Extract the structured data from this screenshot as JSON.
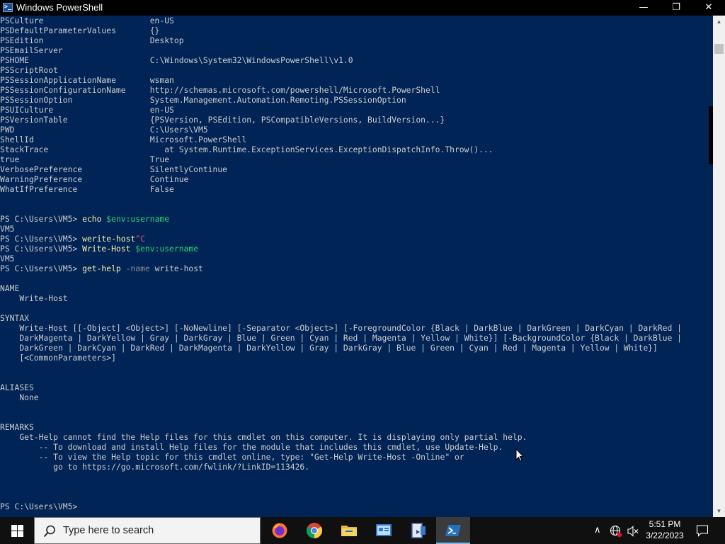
{
  "window": {
    "title": "Windows PowerShell",
    "min_glyph": "—",
    "max_glyph": "❐",
    "close_glyph": "✕"
  },
  "console": {
    "vars": [
      {
        "name": "PSCulture",
        "value": "en-US"
      },
      {
        "name": "PSDefaultParameterValues",
        "value": "{}"
      },
      {
        "name": "PSEdition",
        "value": "Desktop"
      },
      {
        "name": "PSEmailServer",
        "value": ""
      },
      {
        "name": "PSHOME",
        "value": "C:\\Windows\\System32\\WindowsPowerShell\\v1.0"
      },
      {
        "name": "PSScriptRoot",
        "value": ""
      },
      {
        "name": "PSSessionApplicationName",
        "value": "wsman"
      },
      {
        "name": "PSSessionConfigurationName",
        "value": "http://schemas.microsoft.com/powershell/Microsoft.PowerShell"
      },
      {
        "name": "PSSessionOption",
        "value": "System.Management.Automation.Remoting.PSSessionOption"
      },
      {
        "name": "PSUICulture",
        "value": "en-US"
      },
      {
        "name": "PSVersionTable",
        "value": "{PSVersion, PSEdition, PSCompatibleVersions, BuildVersion...}"
      },
      {
        "name": "PWD",
        "value": "C:\\Users\\VM5"
      },
      {
        "name": "ShellId",
        "value": "Microsoft.PowerShell"
      },
      {
        "name": "StackTrace",
        "value": "   at System.Runtime.ExceptionServices.ExceptionDispatchInfo.Throw()..."
      },
      {
        "name": "true",
        "value": "True"
      },
      {
        "name": "VerbosePreference",
        "value": "SilentlyContinue"
      },
      {
        "name": "WarningPreference",
        "value": "Continue"
      },
      {
        "name": "WhatIfPreference",
        "value": "False"
      }
    ],
    "prompt": "PS C:\\Users\\VM5> ",
    "cmd1": {
      "verb": "echo",
      "arg": "$env:username"
    },
    "out1": "VM5",
    "cmd2": {
      "verb": "werite-host",
      "ctrl": "^C"
    },
    "cmd3": {
      "verb": "Write-Host",
      "arg": "$env:username"
    },
    "out3": "VM5",
    "cmd4": {
      "verb": "get-help",
      "param": "-name",
      "arg": "write-host"
    },
    "help": {
      "name_heading": "NAME",
      "name_value": "    Write-Host",
      "syntax_heading": "SYNTAX",
      "syntax_lines": [
        "    Write-Host [[-Object] <Object>] [-NoNewline] [-Separator <Object>] [-ForegroundColor {Black | DarkBlue | DarkGreen | DarkCyan | DarkRed |",
        "    DarkMagenta | DarkYellow | Gray | DarkGray | Blue | Green | Cyan | Red | Magenta | Yellow | White}] [-BackgroundColor {Black | DarkBlue |",
        "    DarkGreen | DarkCyan | DarkRed | DarkMagenta | DarkYellow | Gray | DarkGray | Blue | Green | Cyan | Red | Magenta | Yellow | White}]",
        "    [<CommonParameters>]"
      ],
      "aliases_heading": "ALIASES",
      "aliases_value": "    None",
      "remarks_heading": "REMARKS",
      "remarks_lines": [
        "    Get-Help cannot find the Help files for this cmdlet on this computer. It is displaying only partial help.",
        "        -- To download and install Help files for the module that includes this cmdlet, use Update-Help.",
        "        -- To view the Help topic for this cmdlet online, type: \"Get-Help Write-Host -Online\" or",
        "           go to https://go.microsoft.com/fwlink/?LinkID=113426."
      ]
    },
    "final_prompt": "PS C:\\Users\\VM5> "
  },
  "taskbar": {
    "search_placeholder": "Type here to search",
    "apps": [
      "firefox-icon",
      "chrome-icon",
      "file-explorer-icon",
      "control-panel-icon",
      "powershell-ise-icon",
      "powershell-icon"
    ],
    "clock_time": "5:51 PM",
    "clock_date": "3/22/2023",
    "tray_chevron": "∧",
    "tray_volume_glyph": "🔇"
  },
  "colors": {
    "console_bg": "#012456",
    "console_fg": "#cccccc",
    "command": "#f9f1a5",
    "variable": "#22d66f",
    "parameter": "#8a8a8a",
    "error": "#e74856"
  }
}
